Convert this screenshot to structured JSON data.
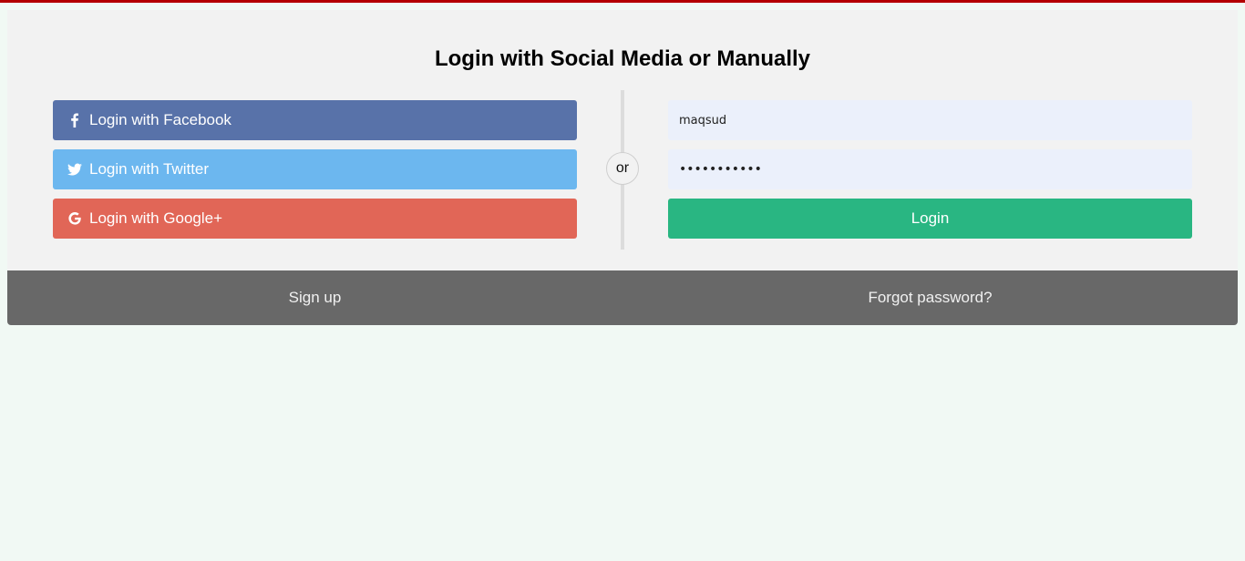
{
  "page": {
    "title": "Login with Social Media or Manually"
  },
  "colors": {
    "top_bar": "#b30000",
    "facebook": "#5872a9",
    "twitter": "#6cb7ef",
    "google": "#e16657",
    "login": "#29b682",
    "footer": "#686868"
  },
  "social": {
    "facebook": {
      "label": "Login with Facebook",
      "icon": "facebook-icon"
    },
    "twitter": {
      "label": "Login with Twitter",
      "icon": "twitter-icon"
    },
    "google": {
      "label": "Login with Google+",
      "icon": "google-icon"
    }
  },
  "divider": {
    "label": "or"
  },
  "form": {
    "username_value": "maqsud",
    "password_value": "•••••••••••",
    "login_label": "Login"
  },
  "footer": {
    "signup_label": "Sign up",
    "forgot_label": "Forgot password?"
  }
}
